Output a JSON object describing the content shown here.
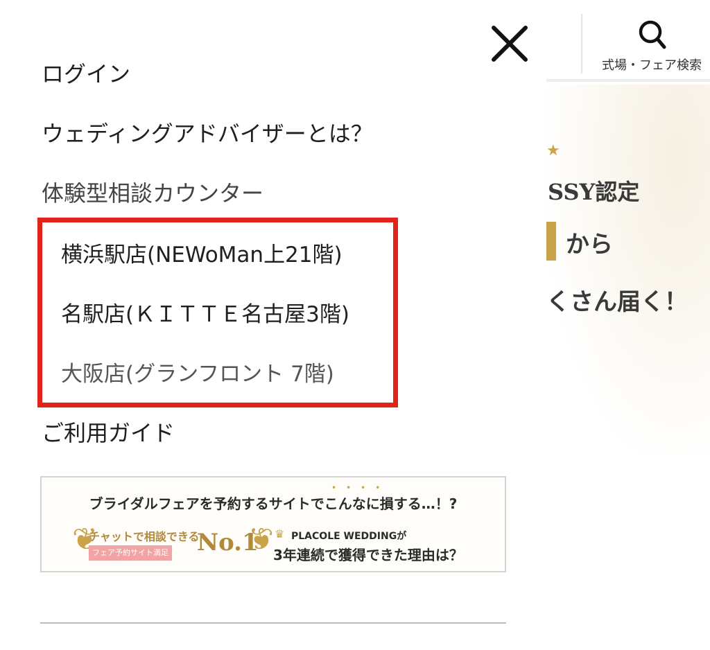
{
  "header": {
    "search_label": "式場・フェア検索"
  },
  "background": {
    "line1": "SSY認定",
    "line2": "から",
    "line3": "くさん届く！"
  },
  "menu": {
    "login": "ログイン",
    "advisor": "ウェディングアドバイザーとは？",
    "counter": "体験型相談カウンター",
    "stores": [
      "横浜駅店(NEWoMan上21階)",
      "名駅店(ＫＩＴＴＥ名古屋3階)",
      "大阪店(グランフロント 7階)"
    ],
    "guide": "ご利用ガイド"
  },
  "banner": {
    "headline": "ブライダルフェアを予約するサイトでこんなに損する…！?",
    "chat_label": "チャットで相談できる",
    "tag": "フェア予約サイト満足",
    "rank": "No.1",
    "brand": "PLACOLE WEDDINGが",
    "reason": "3年連続で獲得できた理由は？"
  },
  "colors": {
    "highlight": "#e2231a",
    "gold": "#c9a24a"
  }
}
